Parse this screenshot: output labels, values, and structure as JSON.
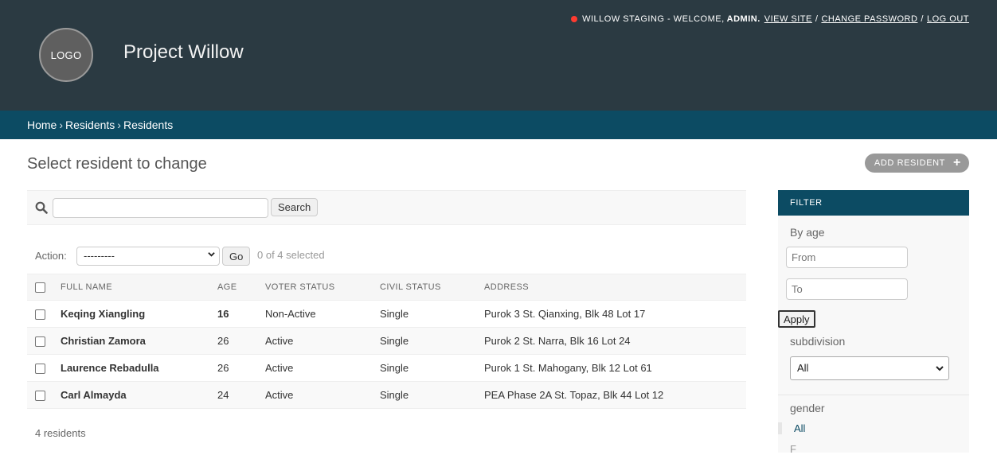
{
  "header": {
    "logo_text": "LOGO",
    "site_title": "Project Willow",
    "user_tools": {
      "env_label": "WILLOW STAGING - WELCOME,",
      "username": "ADMIN.",
      "view_site": "VIEW SITE",
      "change_password": "CHANGE PASSWORD",
      "log_out": "LOG OUT",
      "separator": "/",
      "env_dot_color": "#ff3b30"
    }
  },
  "breadcrumbs": {
    "items": [
      "Home",
      "Residents",
      "Residents"
    ],
    "separator": "›"
  },
  "page": {
    "title": "Select resident to change",
    "add_button": "ADD RESIDENT",
    "add_icon": "plus-icon"
  },
  "search": {
    "value": "",
    "placeholder": "",
    "button": "Search",
    "icon": "search-icon"
  },
  "actions": {
    "label": "Action:",
    "selected_option": "---------",
    "go_button": "Go",
    "counter": "0 of 4 selected"
  },
  "table": {
    "columns": [
      "FULL NAME",
      "AGE",
      "VOTER STATUS",
      "CIVIL STATUS",
      "ADDRESS"
    ],
    "rows": [
      {
        "name": "Keqing Xiangling",
        "age": "16",
        "voter": "Non-Active",
        "civil": "Single",
        "address": "Purok 3 St. Qianxing, Blk 48 Lot 17"
      },
      {
        "name": "Christian Zamora",
        "age": "26",
        "voter": "Active",
        "civil": "Single",
        "address": "Purok 2 St. Narra, Blk 16 Lot 24"
      },
      {
        "name": "Laurence Rebadulla",
        "age": "26",
        "voter": "Active",
        "civil": "Single",
        "address": "Purok 1 St. Mahogany, Blk 12 Lot 61"
      },
      {
        "name": "Carl Almayda",
        "age": "24",
        "voter": "Active",
        "civil": "Single",
        "address": "PEA Phase 2A St. Topaz, Blk 44 Lot 12"
      }
    ]
  },
  "paginator": "4 residents",
  "filter": {
    "title": "FILTER",
    "by_age": "By age",
    "from_placeholder": "From",
    "to_placeholder": "To",
    "apply": "Apply",
    "subdivision_label": "subdivision",
    "subdivision_selected": "All",
    "gender_label": "gender",
    "gender_all": "All",
    "gender_next": "F"
  },
  "colors": {
    "header_bg": "#2b3a42",
    "breadcrumb_bg": "#0c4b63",
    "filter_head_bg": "#0c4b63"
  }
}
